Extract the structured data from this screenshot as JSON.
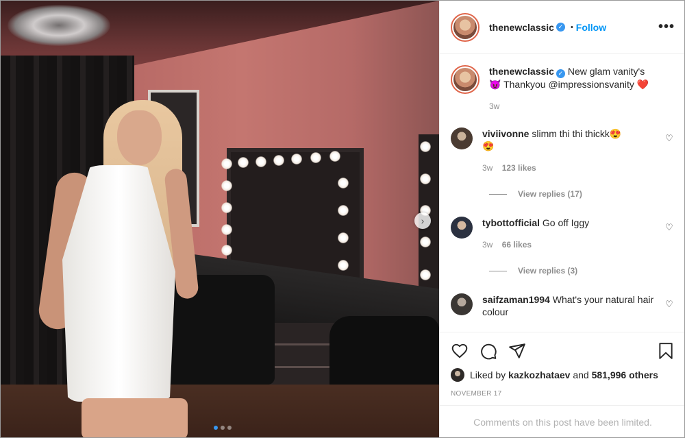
{
  "post": {
    "author": "thenewclassic",
    "follow_label": "Follow",
    "separator": "•",
    "more_icon": "more-horizontal-icon",
    "more_label": "•••"
  },
  "caption": {
    "username": "thenewclassic",
    "line1": "New glam vanity's",
    "line2_start": "😈 Thankyou @impressionsvanity ",
    "line2_end": "❤️",
    "time": "3w"
  },
  "comments": [
    {
      "username": "viviivonne",
      "text": "slimm thi thi thickk😍",
      "text_line2": "😍",
      "time": "3w",
      "likes": "123 likes",
      "replies": "View replies (17)"
    },
    {
      "username": "tybottofficial",
      "text": "Go off Iggy",
      "time": "3w",
      "likes": "66 likes",
      "replies": "View replies (3)"
    },
    {
      "username": "saifzaman1994",
      "text": "What's your natural hair colour"
    }
  ],
  "likes": {
    "prefix": "Liked by ",
    "user": "kazkozhataev",
    "middle": " and ",
    "others": "581,996 others"
  },
  "date": "NOVEMBER 17",
  "comments_limited": "Comments on this post have been limited.",
  "next_arrow": "›",
  "colors": {
    "accent": "#0095f6",
    "verified": "#3897f0",
    "muted": "#8e8e8e"
  }
}
